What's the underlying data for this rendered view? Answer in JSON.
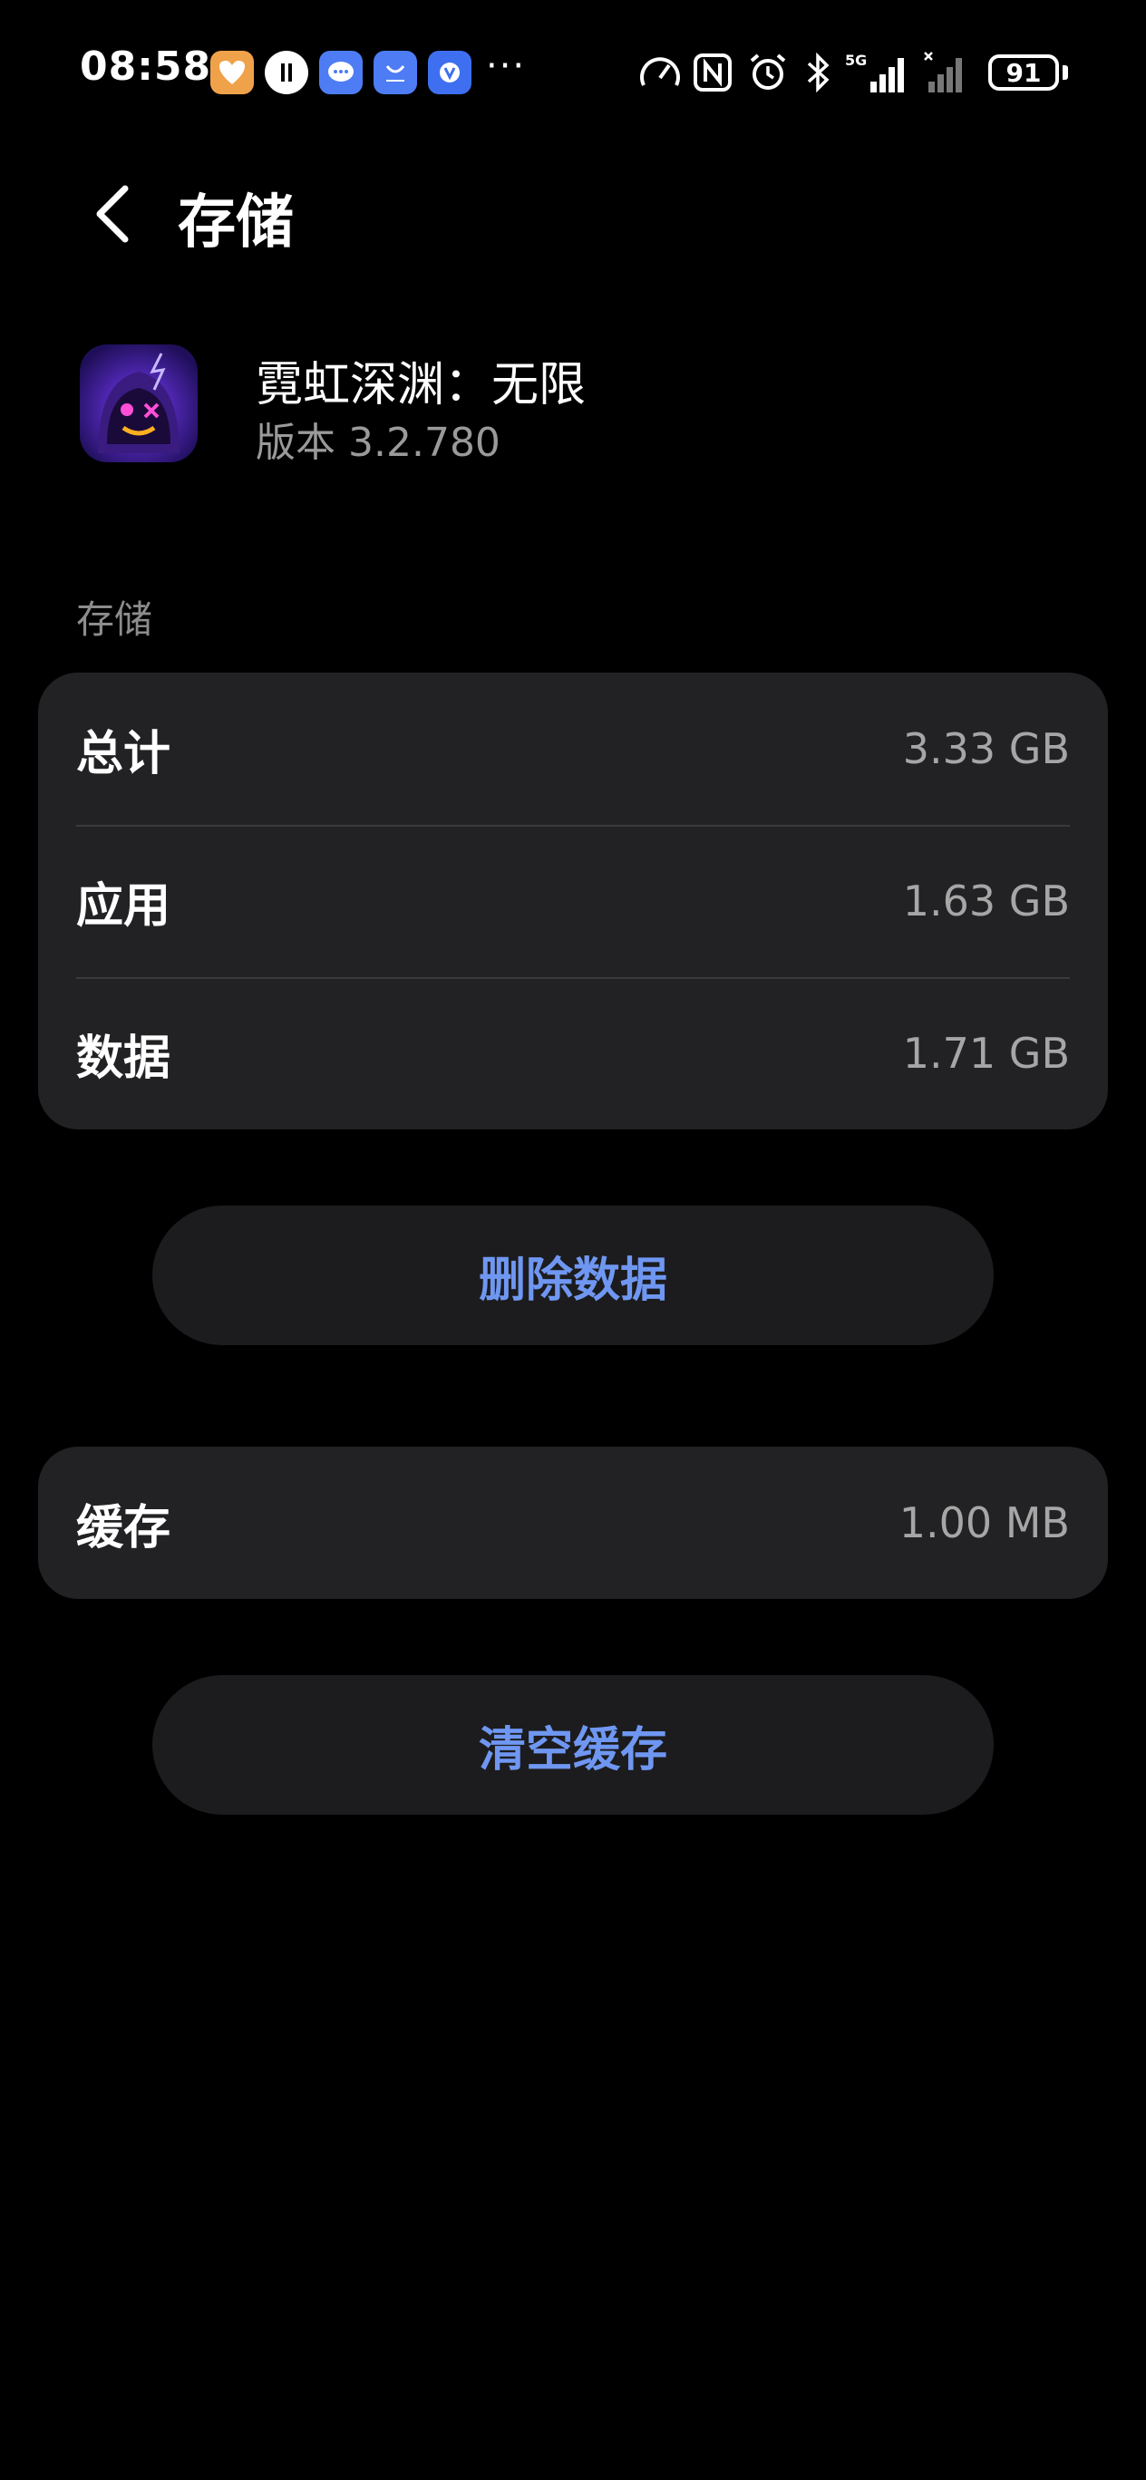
{
  "status_bar": {
    "time": "08:58",
    "battery": "91",
    "network": "5G",
    "more": "···"
  },
  "header": {
    "title": "存储"
  },
  "app": {
    "name": "霓虹深渊：无限",
    "version": "版本 3.2.780"
  },
  "storage": {
    "section_label": "存储",
    "rows": [
      {
        "label": "总计",
        "value": "3.33 GB"
      },
      {
        "label": "应用",
        "value": "1.63 GB"
      },
      {
        "label": "数据",
        "value": "1.71 GB"
      }
    ]
  },
  "actions": {
    "delete_data": "删除数据",
    "clear_cache": "清空缓存"
  },
  "cache": {
    "label": "缓存",
    "value": "1.00 MB"
  },
  "colors": {
    "accent": "#6f97f2",
    "card": "#222224",
    "background": "#000000"
  }
}
